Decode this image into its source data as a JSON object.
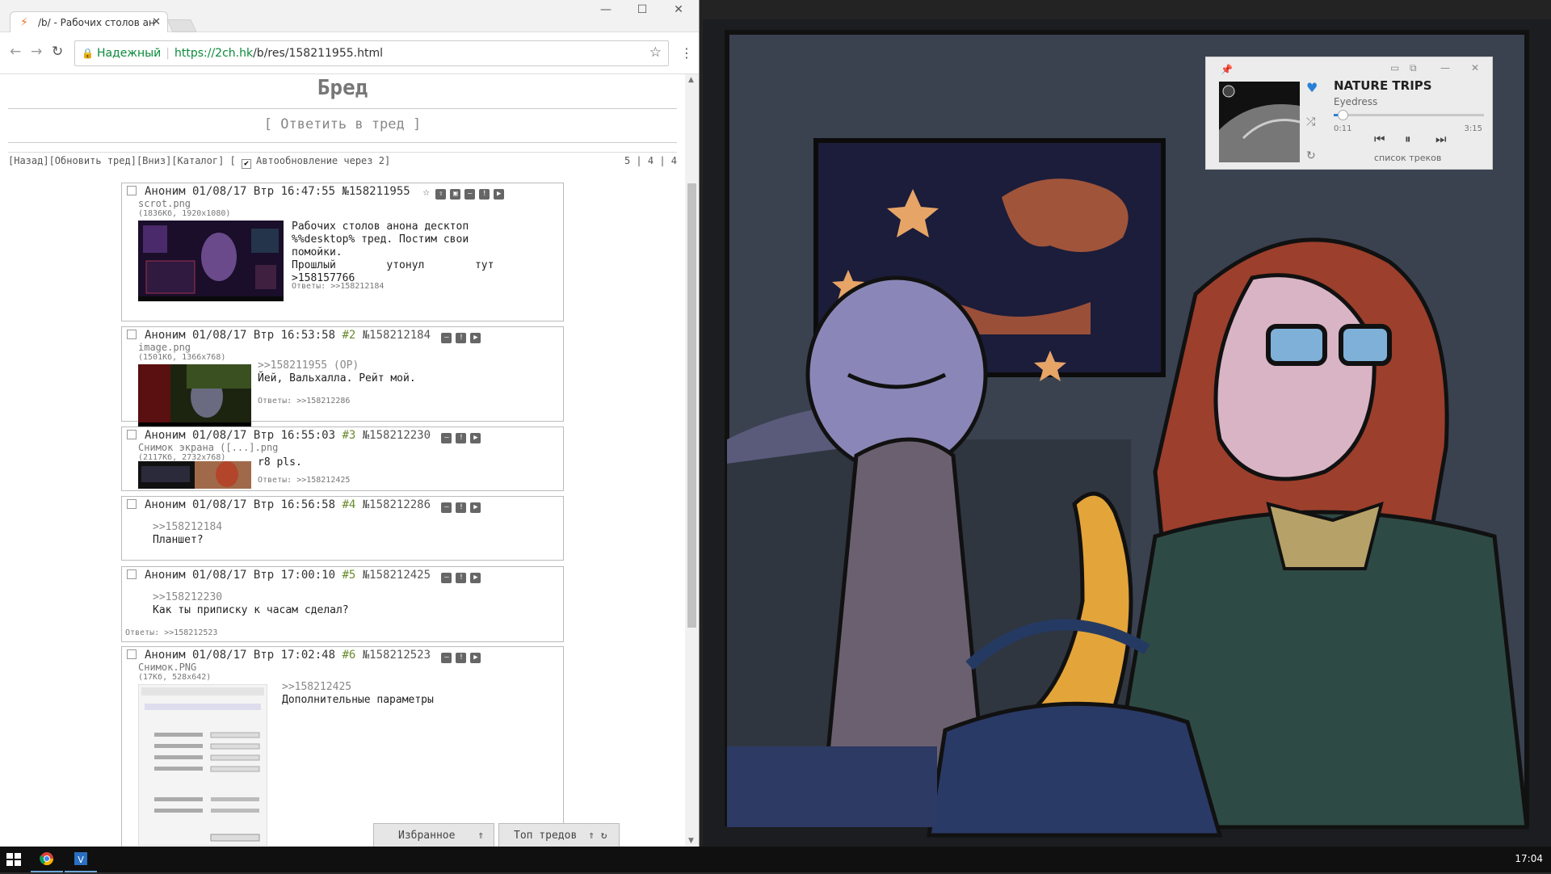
{
  "browser": {
    "tab_title": "/b/ - Рабочих столов ан",
    "security_label": "Надежный",
    "url_host": "https://2ch.hk",
    "url_path": "/b/res/158211955.html"
  },
  "board": {
    "title": "Бред",
    "reply_link": "[ Ответить в тред ]",
    "nav_links": "[Назад][Обновить тред][Вниз][Каталог] [",
    "autoupdate_label": "Автообновление через 2]",
    "counts": "5 | 4 | 4"
  },
  "posts": [
    {
      "header": "Аноним 01/08/17 Втр 16:47:55 №158211955",
      "file_name": "scrot.png",
      "file_meta": "(1836Кб, 1920x1080)",
      "text": "Рабочих столов анона десктоп\n%%desktop% тред. Постим свои\nпомойки.\nПрошлый        утонул        тут\n>158157766",
      "replies_label": "Ответы:",
      "replies": ">>158212184"
    },
    {
      "header": "Аноним 01/08/17 Втр 16:53:58",
      "num": "#2",
      "id": "№158212184",
      "file_name": "image.png",
      "file_meta": "(1501Кб, 1366x768)",
      "ref": ">>158211955 (OP)",
      "text": "Йей, Вальхалла. Рейт мой.",
      "replies_label": "Ответы:",
      "replies": ">>158212286"
    },
    {
      "header": "Аноним 01/08/17 Втр 16:55:03",
      "num": "#3",
      "id": "№158212230",
      "file_name": "Снимок экрана ([...].png",
      "file_meta": "(2117Кб, 2732x768)",
      "text": "r8 pls.",
      "replies_label": "Ответы:",
      "replies": ">>158212425"
    },
    {
      "header": "Аноним 01/08/17 Втр 16:56:58",
      "num": "#4",
      "id": "№158212286",
      "ref": ">>158212184",
      "text": "Планшет?"
    },
    {
      "header": "Аноним 01/08/17 Втр 17:00:10",
      "num": "#5",
      "id": "№158212425",
      "ref": ">>158212230",
      "text": "Как ты приписку к часам сделал?",
      "replies_label": "Ответы:",
      "replies": ">>158212523"
    },
    {
      "header": "Аноним 01/08/17 Втр 17:02:48",
      "num": "#6",
      "id": "№158212523",
      "file_name": "Снимок.PNG",
      "file_meta": "(17Кб, 528x642)",
      "ref": ">>158212425",
      "text": "Дополнительные параметры"
    }
  ],
  "footer": {
    "favorites": "Избранное",
    "top_threads": "Топ тредов"
  },
  "player": {
    "title": "NATURE TRIPS",
    "artist": "Eyedress",
    "elapsed": "0:11",
    "duration": "3:15",
    "progress": 0.06,
    "tracklist": "список треков"
  },
  "taskbar": {
    "clock": "17:04"
  }
}
